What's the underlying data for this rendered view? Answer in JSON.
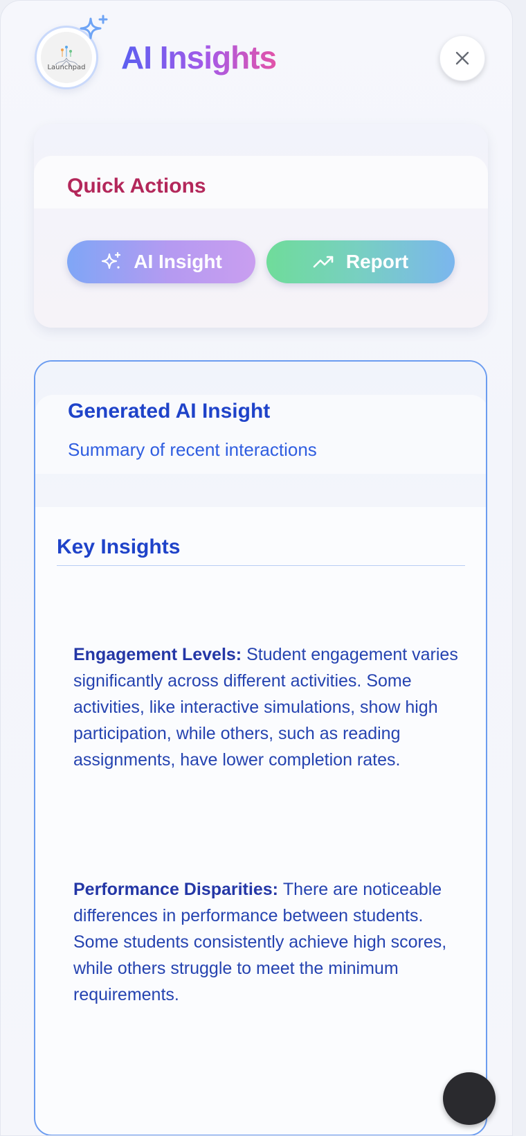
{
  "header": {
    "logo_text": "Launchpad",
    "title": "AI Insights",
    "close_icon": "close-icon",
    "badge_icon": "sparkle-icon"
  },
  "quick_actions": {
    "title": "Quick Actions",
    "buttons": [
      {
        "label": "AI Insight",
        "icon": "sparkle-icon"
      },
      {
        "label": "Report",
        "icon": "trending-up-icon"
      }
    ]
  },
  "generated_insight": {
    "title": "Generated AI Insight",
    "subtitle": "Summary of recent interactions",
    "section_title": "Key Insights",
    "items": [
      {
        "lead": "Engagement Levels:",
        "text": "Student engagement varies significantly across different activities. Some activities, like interactive simulations, show high participation, while others, such as reading assignments, have lower completion rates."
      },
      {
        "lead": "Performance Disparities:",
        "text": "There are noticeable differences in performance between students. Some students consistently achieve high scores, while others struggle to meet the minimum requirements."
      }
    ]
  },
  "colors": {
    "title_gradient": [
      "#5b5ff0",
      "#a45ae8",
      "#e254a8"
    ],
    "quick_actions_title": "#b3275a",
    "insight_blue": "#1f43c9",
    "card_border": "#6b9cf0"
  }
}
